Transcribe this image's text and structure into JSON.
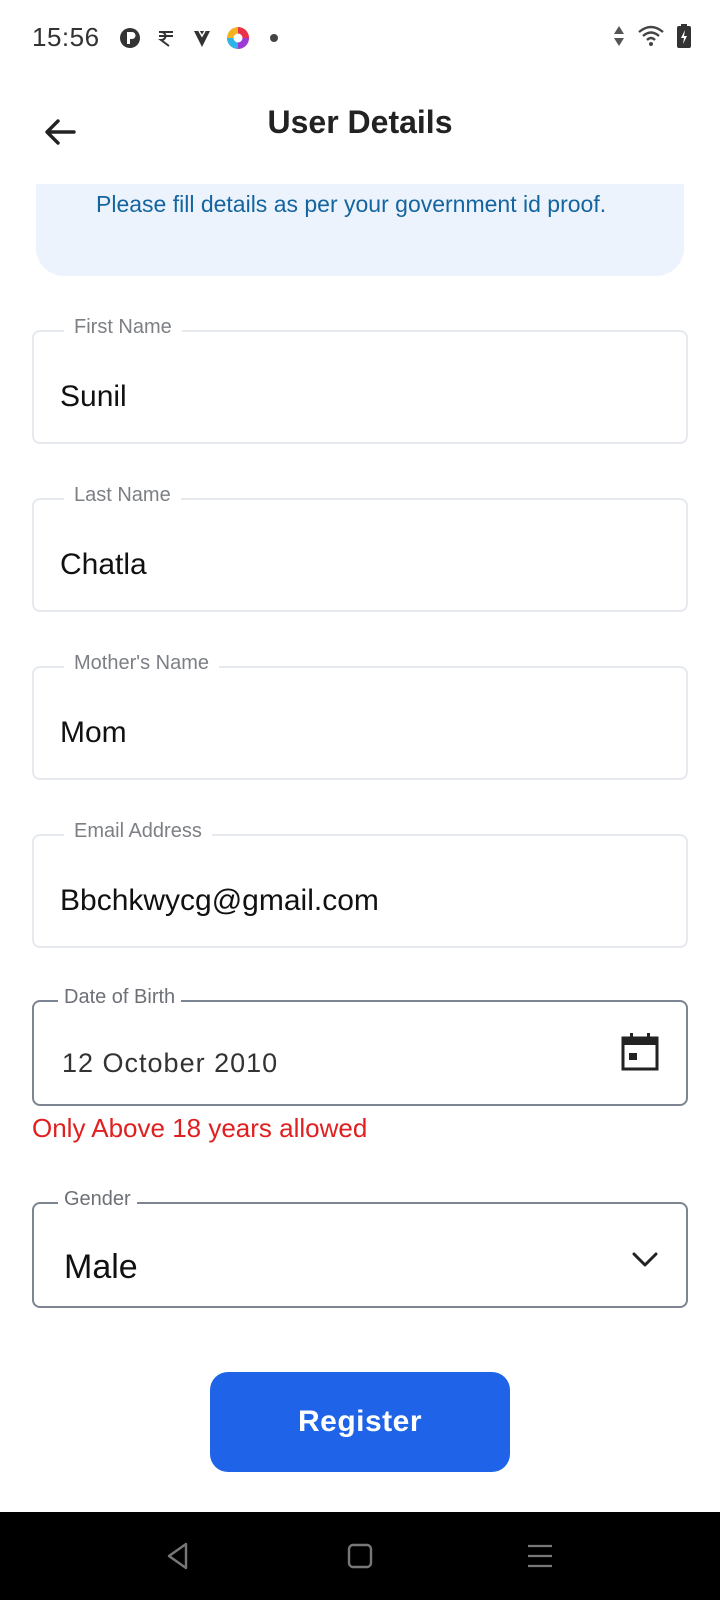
{
  "status_bar": {
    "time": "15:56",
    "left_icons": [
      "p-app-icon",
      "rupee-app-icon",
      "shield-app-icon",
      "color-app-icon",
      "notification-dot-icon"
    ],
    "right_icons": [
      "data-arrows-icon",
      "wifi-icon",
      "battery-charging-icon"
    ]
  },
  "header": {
    "title": "User Details",
    "back_icon": "arrow-left-icon"
  },
  "notice": {
    "text": "Please fill details as per your government id proof."
  },
  "form": {
    "first_name": {
      "label": "First Name",
      "value": "Sunil"
    },
    "last_name": {
      "label": "Last Name",
      "value": "Chatla"
    },
    "mother_name": {
      "label": "Mother's Name",
      "value": "Mom"
    },
    "email": {
      "label": "Email Address",
      "value": "Bbchkwycg@gmail.com"
    },
    "dob": {
      "label": "Date of Birth",
      "value": "12 October 2010",
      "icon": "calendar-icon",
      "error": "Only Above 18 years allowed"
    },
    "gender": {
      "label": "Gender",
      "value": "Male",
      "icon": "chevron-down-icon"
    }
  },
  "register_button": {
    "label": "Register"
  },
  "nav_bar": {
    "buttons": [
      "back-triangle-icon",
      "home-square-icon",
      "menu-lines-icon"
    ]
  },
  "colors": {
    "accent": "#1f63e8",
    "notice_bg": "#edf3fc",
    "notice_text": "#13659f",
    "error": "#e02020"
  }
}
